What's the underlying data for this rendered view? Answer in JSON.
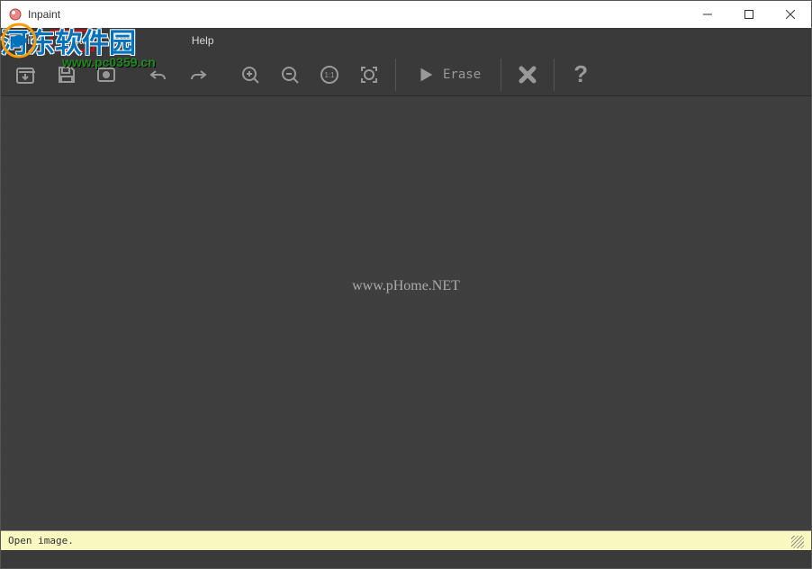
{
  "window": {
    "title": "Inpaint"
  },
  "menubar": {
    "items": [
      {
        "label": "File"
      },
      {
        "label": "Edit"
      },
      {
        "label": "View"
      },
      {
        "label": "Help"
      }
    ]
  },
  "toolbar": {
    "erase_label": "Erase"
  },
  "canvas": {
    "watermark_text": "www.pHome.NET"
  },
  "statusbar": {
    "text": "Open image."
  },
  "overlay_watermark": {
    "chinese": "河东软件园",
    "url": "www.pc0359.cn"
  }
}
